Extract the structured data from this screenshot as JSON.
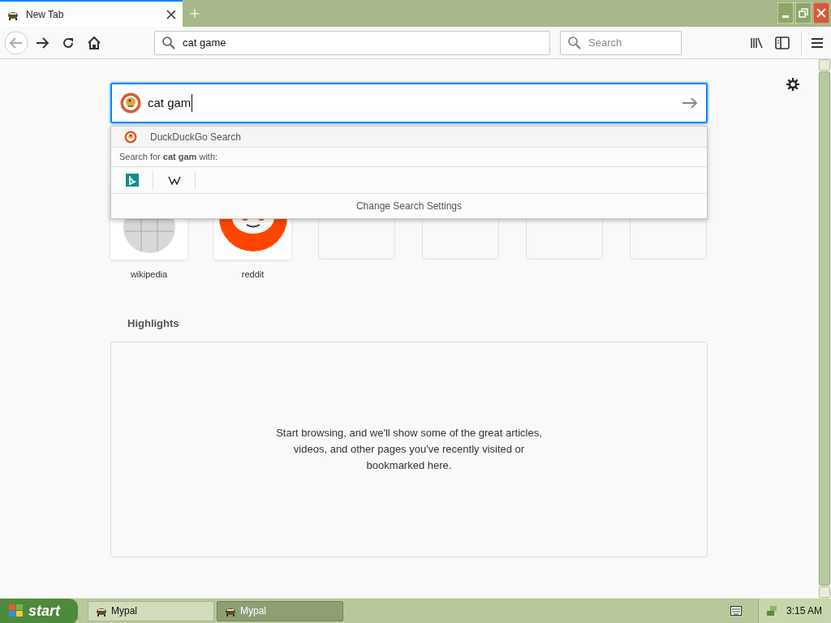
{
  "tabs": [
    {
      "title": "New Tab",
      "selected": true
    }
  ],
  "new_tab_button": "+",
  "toolbar": {
    "url": "cat game",
    "search_placeholder": "Search"
  },
  "page": {
    "search_value": "cat gam",
    "dropdown": {
      "engine_label": "DuckDuckGo Search",
      "search_for": "Search for **cat gam** with:",
      "engines": [
        {
          "kind": "bing"
        },
        {
          "kind": "wikipedia"
        }
      ],
      "settings": "Change Search Settings"
    },
    "top_sites": [
      {
        "kind": "wikipedia",
        "label": "wikipedia"
      },
      {
        "kind": "reddit",
        "label": "reddit"
      },
      {
        "kind": "empty"
      },
      {
        "kind": "empty"
      },
      {
        "kind": "empty"
      },
      {
        "kind": "empty"
      }
    ],
    "highlights": {
      "title": "Highlights",
      "message": "Start browsing, and we'll show some of the great articles, videos, and other pages you've recently visited or bookmarked here."
    }
  },
  "taskbar": {
    "start": "start",
    "tasks": [
      {
        "label": "Mypal",
        "selected": false
      },
      {
        "label": "Mypal",
        "selected": true
      }
    ],
    "clock": "3:15 AM"
  }
}
